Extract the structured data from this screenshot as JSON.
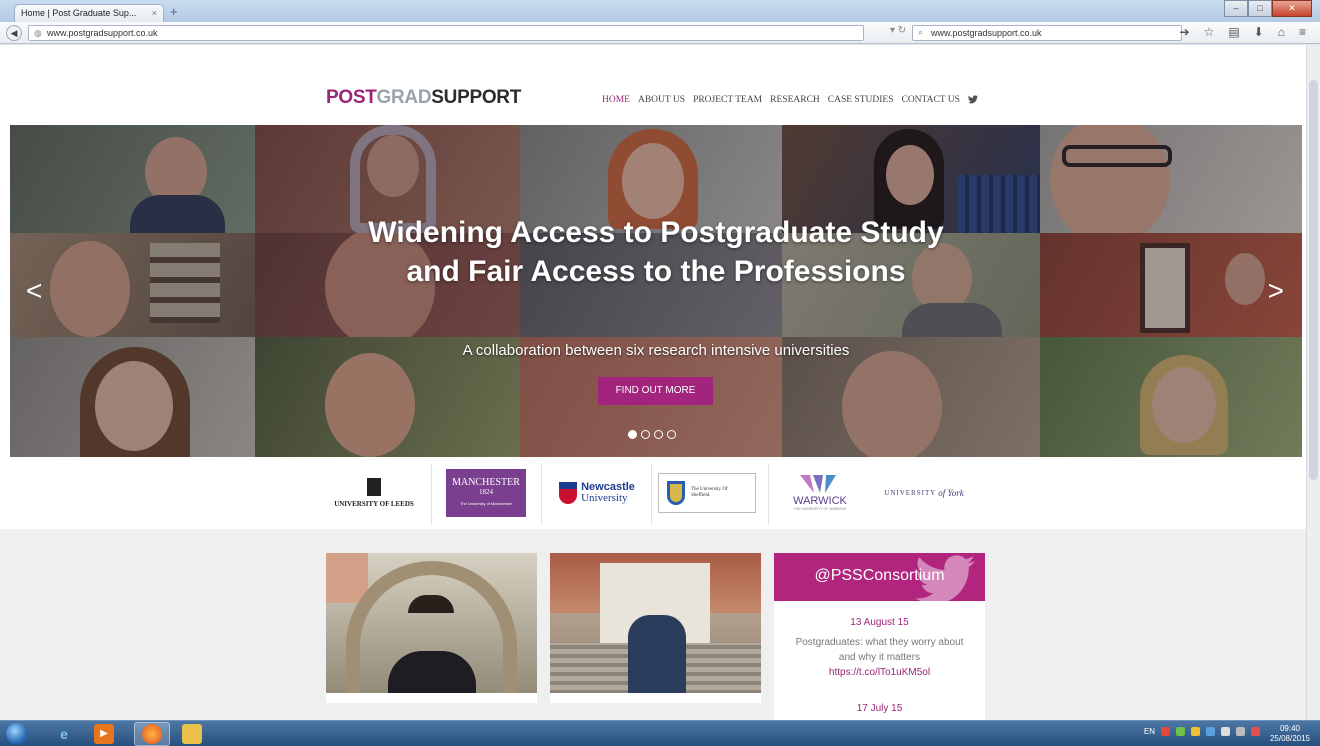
{
  "browser": {
    "tab_title": "Home | Post Graduate Sup...",
    "tab_close": "×",
    "new_tab": "+",
    "url": "www.postgradsupport.co.uk",
    "search_text": "www.postgradsupport.co.uk",
    "window_buttons": [
      "–",
      "□",
      "✕"
    ]
  },
  "site": {
    "logo": {
      "part1": "POST",
      "part2": "GRAD",
      "part3": "SUPPORT"
    },
    "nav": [
      "HOME",
      "ABOUT US",
      "PROJECT TEAM",
      "RESEARCH",
      "CASE STUDIES",
      "CONTACT US"
    ],
    "active_nav": "HOME"
  },
  "hero": {
    "title": "Widening Access to Postgraduate Study and Fair Access to the Professions",
    "subtitle": "A collaboration between six research intensive universities",
    "button": "FIND OUT MORE",
    "prev_arrow": "<",
    "next_arrow": ">",
    "slide_count": 4,
    "active_slide": 1
  },
  "partners": [
    {
      "name": "UNIVERSITY OF LEEDS"
    },
    {
      "name": "MANCHESTER",
      "year": "1824",
      "sub": "The University of Manchester"
    },
    {
      "name": "Newcastle",
      "sub": "University"
    },
    {
      "name": "The University Of Sheffield."
    },
    {
      "name": "WARWICK",
      "sub": "THE UNIVERSITY OF WARWICK"
    },
    {
      "name": "UNIVERSITY",
      "sub": "of York"
    }
  ],
  "twitter": {
    "handle": "@PSSConsortium",
    "tweets": [
      {
        "date": "13 August 15",
        "text": "Postgraduates: what they worry about and why it matters",
        "link": "https://t.co/lTo1uKM5ol"
      },
      {
        "date": "17 July 15"
      }
    ]
  },
  "taskbar": {
    "lang": "EN",
    "time": "09:40",
    "date": "25/08/2015"
  },
  "colors": {
    "brand": "#9b2578",
    "twitter_bg": "#b1257f"
  }
}
